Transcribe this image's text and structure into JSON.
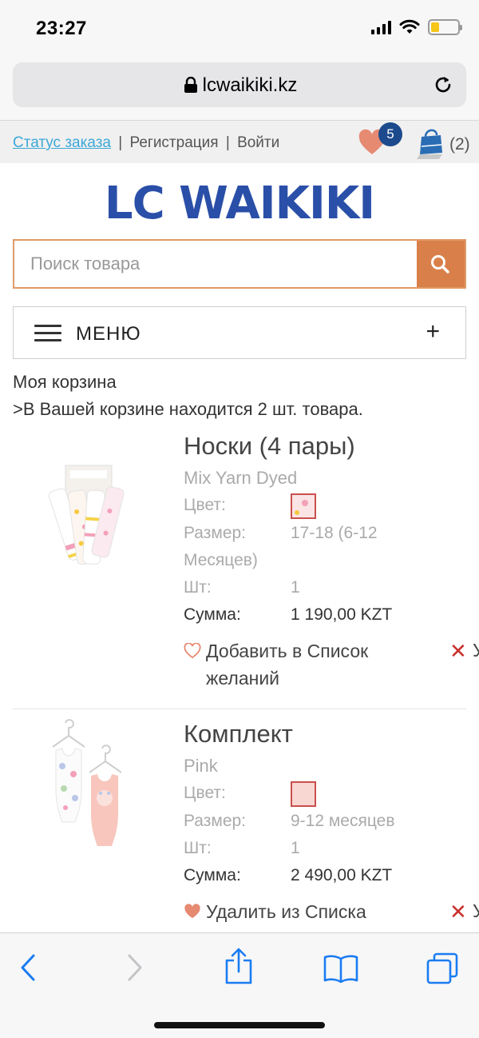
{
  "status_bar": {
    "time": "23:27"
  },
  "browser": {
    "url": "lcwaikiki.kz"
  },
  "top_links": {
    "order_status": "Статус заказа",
    "register": "Регистрация",
    "login": "Войти",
    "separator": "|",
    "favorites_count": "5",
    "cart_count": "(2)"
  },
  "logo": {
    "text": "LC WAIKIKI"
  },
  "search": {
    "placeholder": "Поиск товара"
  },
  "menu": {
    "label": "МЕНЮ",
    "expand": "+"
  },
  "cart": {
    "title": "Моя корзина",
    "subtitle": ">В Вашей корзине находится 2 шт. товара."
  },
  "labels": {
    "color": "Цвет:",
    "size": "Размер:",
    "qty": "Шт:",
    "sum": "Сумма:"
  },
  "products": [
    {
      "name": "Носки (4 пары)",
      "variant": "Mix Yarn Dyed",
      "size_line1": "17-18 (6-12",
      "size_line2": "Месяцев)",
      "qty": "1",
      "sum": "1 190,00 KZT",
      "wishlist_line1": "Добавить в Список",
      "wishlist_line2": "желаний",
      "remove": "У",
      "swatch_color": "#fbe4e4"
    },
    {
      "name": "Комплект",
      "variant": "Pink",
      "size_line1": "9-12 месяцев",
      "qty": "1",
      "sum": "2 490,00 KZT",
      "wishlist_line1": "Удалить из Списка",
      "remove": "У",
      "swatch_color": "#f8d6d2"
    }
  ],
  "colors": {
    "accent_orange": "#d9804a",
    "brand_blue": "#2a4fa8",
    "link_blue": "#3da8d8",
    "badge_blue": "#1c4a8c",
    "heart": "#e68a72",
    "remove_red": "#c9302c"
  },
  "icons": {
    "lock": "lock-icon",
    "reload": "reload-icon",
    "heart": "heart-icon",
    "cart": "shopping-bag-icon",
    "search": "search-icon",
    "menu": "hamburger-icon",
    "back": "back-icon",
    "forward": "forward-icon",
    "share": "share-icon",
    "bookmarks": "bookmarks-icon",
    "tabs": "tabs-icon"
  }
}
